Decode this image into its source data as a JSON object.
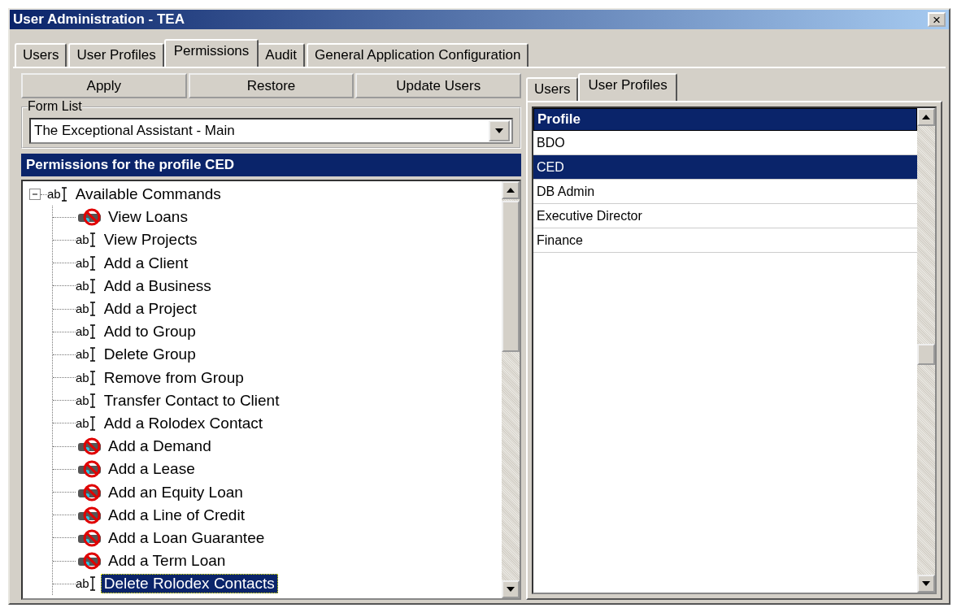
{
  "window": {
    "title": "User Administration - TEA",
    "close": "×"
  },
  "tabs": [
    {
      "label": "Users",
      "selected": false
    },
    {
      "label": "User Profiles",
      "selected": false
    },
    {
      "label": "Permissions",
      "selected": true
    },
    {
      "label": "Audit",
      "selected": false
    },
    {
      "label": "General Application Configuration",
      "selected": false
    }
  ],
  "buttons": [
    "Apply",
    "Restore",
    "Update Users"
  ],
  "form_list": {
    "label": "Form List",
    "value": "The Exceptional Assistant - Main"
  },
  "permissions_header": "Permissions for the profile CED",
  "tree": {
    "label": "Available Commands",
    "kind": "allowed",
    "icon_text": "ab",
    "expanded": true,
    "selected": false,
    "children": [
      {
        "label": "View Loans",
        "kind": "denied",
        "selected": false
      },
      {
        "label": "View Projects",
        "kind": "allowed",
        "icon_text": "ab",
        "selected": false
      },
      {
        "label": "Add a Client",
        "kind": "allowed",
        "icon_text": "ab",
        "selected": false
      },
      {
        "label": "Add a Business",
        "kind": "allowed",
        "icon_text": "ab",
        "selected": false
      },
      {
        "label": "Add a Project",
        "kind": "allowed",
        "icon_text": "ab",
        "selected": false
      },
      {
        "label": "Add to Group",
        "kind": "allowed",
        "icon_text": "ab",
        "selected": false
      },
      {
        "label": "Delete Group",
        "kind": "allowed",
        "icon_text": "ab",
        "selected": false
      },
      {
        "label": "Remove from Group",
        "kind": "allowed",
        "icon_text": "ab",
        "selected": false
      },
      {
        "label": "Transfer Contact to Client",
        "kind": "allowed",
        "icon_text": "ab",
        "selected": false
      },
      {
        "label": "Add a Rolodex Contact",
        "kind": "allowed",
        "icon_text": "ab",
        "selected": false
      },
      {
        "label": "Add a Demand",
        "kind": "denied",
        "selected": false
      },
      {
        "label": "Add a Lease",
        "kind": "denied",
        "selected": false
      },
      {
        "label": "Add an Equity Loan",
        "kind": "denied",
        "selected": false
      },
      {
        "label": "Add a Line of Credit",
        "kind": "denied",
        "selected": false
      },
      {
        "label": "Add a Loan Guarantee",
        "kind": "denied",
        "selected": false
      },
      {
        "label": "Add a Term Loan",
        "kind": "denied",
        "selected": false
      },
      {
        "label": "Delete Rolodex Contacts",
        "kind": "allowed",
        "icon_text": "ab",
        "selected": true
      }
    ]
  },
  "right_tabs": [
    {
      "label": "Users",
      "selected": false
    },
    {
      "label": "User Profiles",
      "selected": true
    }
  ],
  "profiles": {
    "column": "Profile",
    "rows": [
      {
        "name": "BDO",
        "selected": false
      },
      {
        "name": "CED",
        "selected": true
      },
      {
        "name": "DB Admin",
        "selected": false
      },
      {
        "name": "Executive Director",
        "selected": false
      },
      {
        "name": "Finance",
        "selected": false
      }
    ]
  }
}
